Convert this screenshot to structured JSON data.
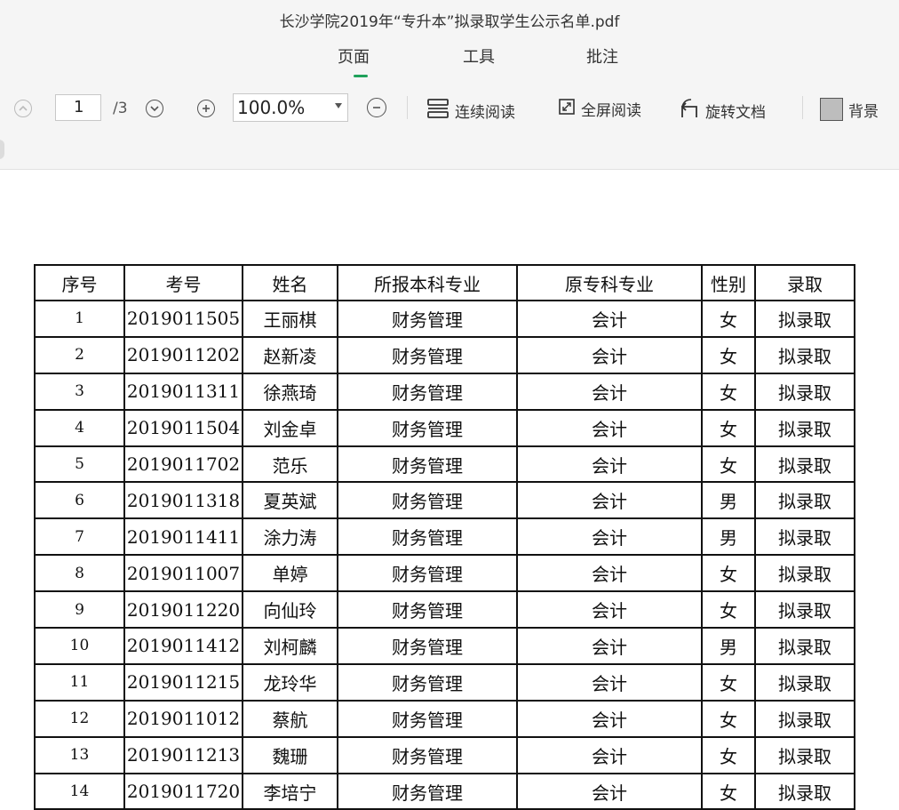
{
  "document": {
    "title": "长沙学院2019年“专升本”拟录取学生公示名单.pdf"
  },
  "tabs": [
    "页面",
    "工具",
    "批注"
  ],
  "toolbar": {
    "page_current": "1",
    "page_total": "/3",
    "zoom": "100.0%",
    "continuous_read": "连续阅读",
    "fullscreen_read": "全屏阅读",
    "rotate_doc": "旋转文档",
    "background": "背景"
  },
  "colors": {
    "accent": "#1fa15a",
    "toolbar_bg": "#f5f5f5"
  },
  "icons": [
    "prev-page-icon",
    "next-page-icon",
    "zoom-in-icon",
    "zoom-out-icon",
    "continuous-read-icon",
    "fullscreen-icon",
    "rotate-icon",
    "background-swatch"
  ],
  "table": {
    "headers": [
      "序号",
      "考号",
      "姓名",
      "所报本科专业",
      "原专科专业",
      "性别",
      "录取"
    ],
    "rows": [
      [
        "1",
        "2019011505",
        "王丽棋",
        "财务管理",
        "会计",
        "女",
        "拟录取"
      ],
      [
        "2",
        "2019011202",
        "赵新凌",
        "财务管理",
        "会计",
        "女",
        "拟录取"
      ],
      [
        "3",
        "2019011311",
        "徐燕琦",
        "财务管理",
        "会计",
        "女",
        "拟录取"
      ],
      [
        "4",
        "2019011504",
        "刘金卓",
        "财务管理",
        "会计",
        "女",
        "拟录取"
      ],
      [
        "5",
        "2019011702",
        "范乐",
        "财务管理",
        "会计",
        "女",
        "拟录取"
      ],
      [
        "6",
        "2019011318",
        "夏英斌",
        "财务管理",
        "会计",
        "男",
        "拟录取"
      ],
      [
        "7",
        "2019011411",
        "涂力涛",
        "财务管理",
        "会计",
        "男",
        "拟录取"
      ],
      [
        "8",
        "2019011007",
        "单婷",
        "财务管理",
        "会计",
        "女",
        "拟录取"
      ],
      [
        "9",
        "2019011220",
        "向仙玲",
        "财务管理",
        "会计",
        "女",
        "拟录取"
      ],
      [
        "10",
        "2019011412",
        "刘柯麟",
        "财务管理",
        "会计",
        "男",
        "拟录取"
      ],
      [
        "11",
        "2019011215",
        "龙玲华",
        "财务管理",
        "会计",
        "女",
        "拟录取"
      ],
      [
        "12",
        "2019011012",
        "蔡航",
        "财务管理",
        "会计",
        "女",
        "拟录取"
      ],
      [
        "13",
        "2019011213",
        "魏珊",
        "财务管理",
        "会计",
        "女",
        "拟录取"
      ],
      [
        "14",
        "2019011720",
        "李培宁",
        "财务管理",
        "会计",
        "女",
        "拟录取"
      ]
    ]
  }
}
